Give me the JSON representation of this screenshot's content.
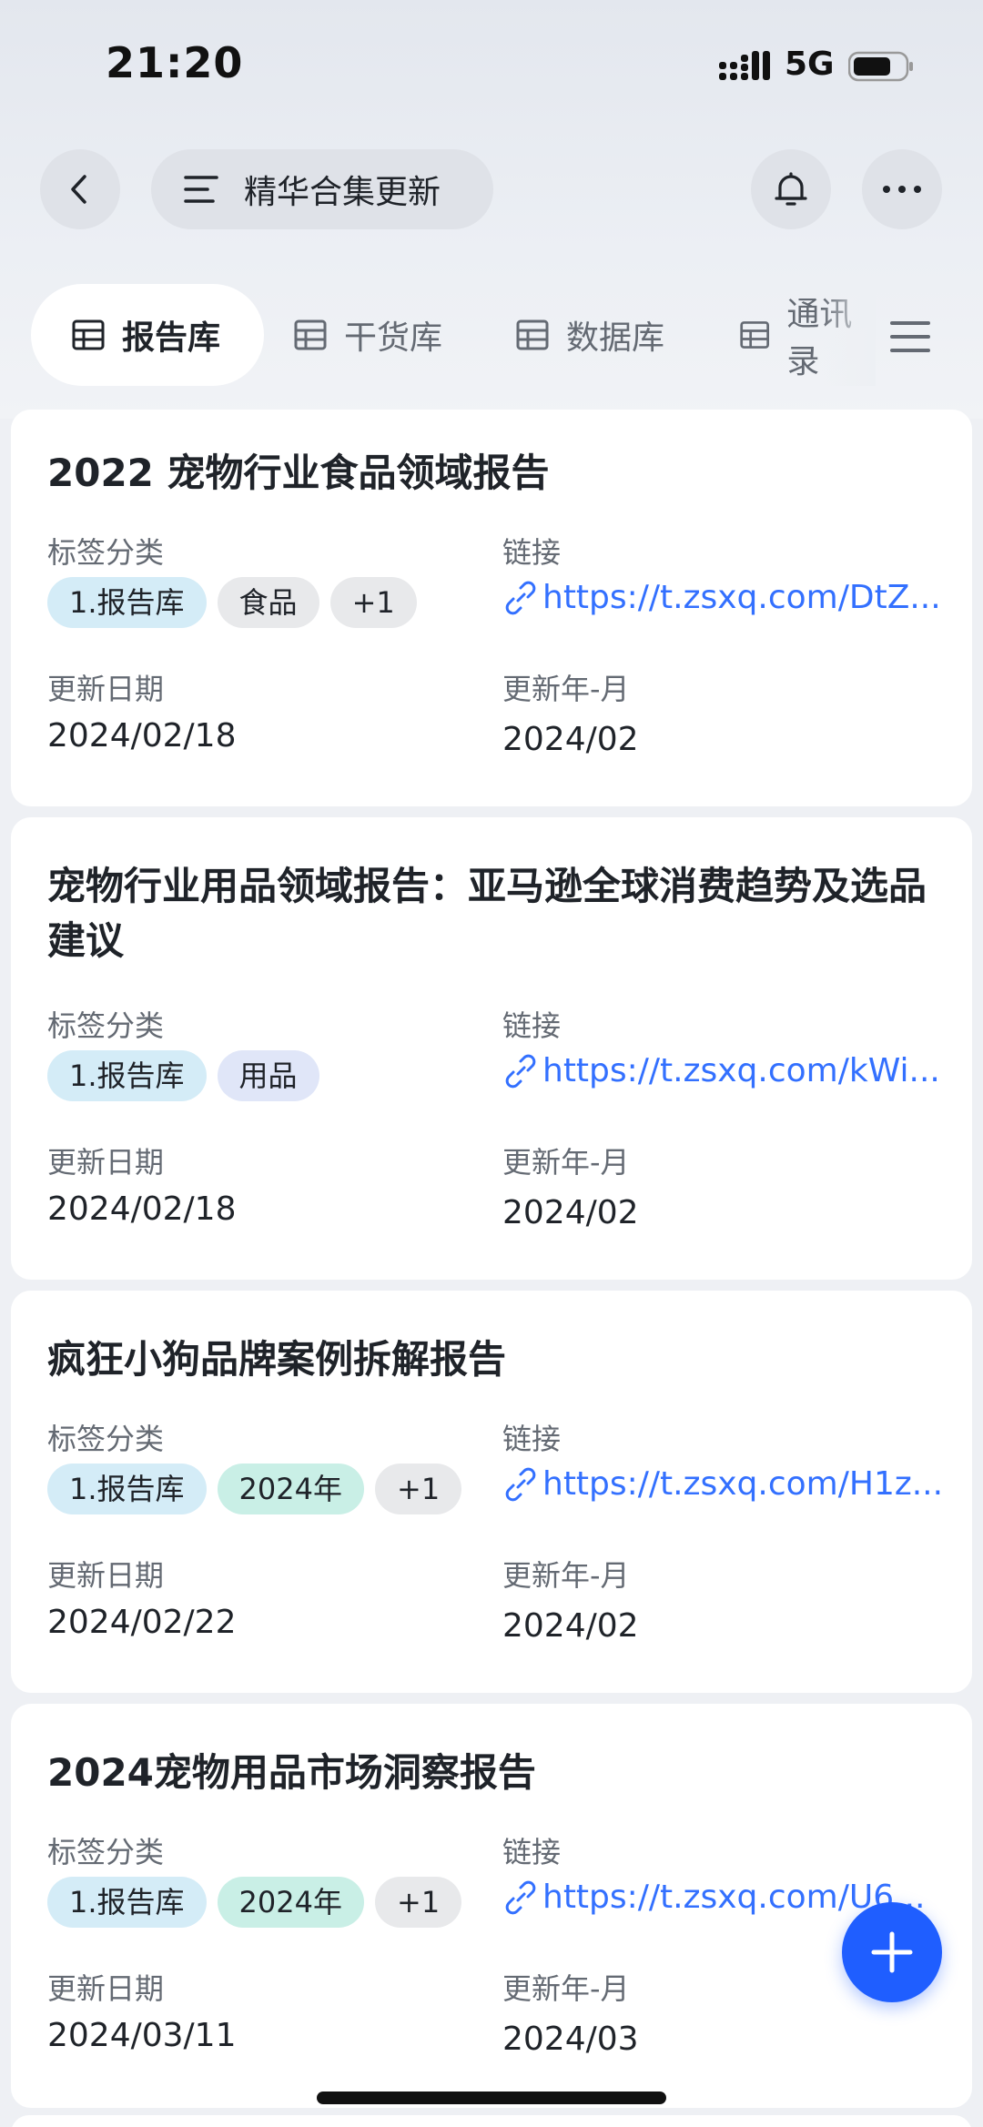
{
  "status_bar": {
    "time": "21:20",
    "network": "5G"
  },
  "header": {
    "title": "精华合集更新"
  },
  "tabs": [
    {
      "label": "报告库",
      "active": true
    },
    {
      "label": "干货库",
      "active": false
    },
    {
      "label": "数据库",
      "active": false
    },
    {
      "label": "通讯录",
      "active": false
    }
  ],
  "field_labels": {
    "tags": "标签分类",
    "link": "链接",
    "update_date": "更新日期",
    "update_month": "更新年-月"
  },
  "cards": [
    {
      "title": "2022 宠物行业食品领域报告",
      "tags": [
        "1.报告库",
        "食品",
        "+1"
      ],
      "link": "https://t.zsxq.com/DtZ...",
      "update_date": "2024/02/18",
      "update_month": "2024/02"
    },
    {
      "title": "宠物行业用品领域报告：亚马逊全球消费趋势及选品建议",
      "tags": [
        "1.报告库",
        "用品"
      ],
      "link": "https://t.zsxq.com/kWi...",
      "update_date": "2024/02/18",
      "update_month": "2024/02"
    },
    {
      "title": "疯狂小狗品牌案例拆解报告",
      "tags": [
        "1.报告库",
        "2024年",
        "+1"
      ],
      "link": "https://t.zsxq.com/H1z...",
      "update_date": "2024/02/22",
      "update_month": "2024/02"
    },
    {
      "title": "2024宠物用品市场洞察报告",
      "tags": [
        "1.报告库",
        "2024年",
        "+1"
      ],
      "link": "https://t.zsxq.com/U6...",
      "update_date": "2024/03/11",
      "update_month": "2024/03"
    }
  ],
  "colors": {
    "accent": "#3370ff",
    "fab": "#1f5eff"
  },
  "icons": [
    "back-icon",
    "list-icon",
    "bell-icon",
    "more-icon",
    "table-icon",
    "menu-icon",
    "link-icon",
    "plus-icon"
  ]
}
